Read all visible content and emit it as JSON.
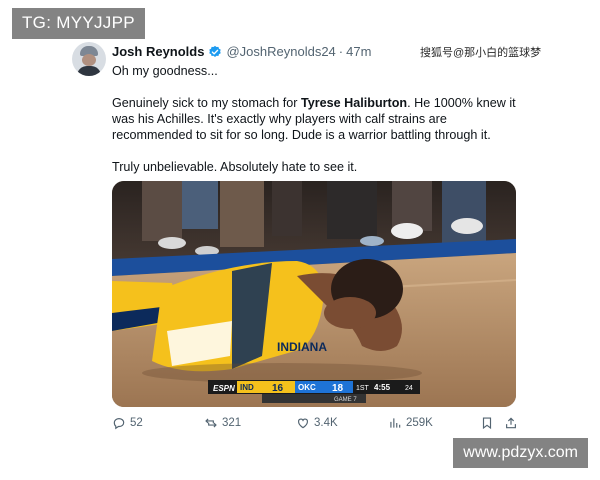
{
  "overlay": {
    "tag": "TG: MYYJJPP",
    "site": "www.pdzyx.com"
  },
  "watermark": "搜狐号@那小白的篮球梦",
  "tweet": {
    "author_name": "Josh Reynolds",
    "handle": "@JoshReynolds24",
    "time": "47m",
    "paragraph1": "Oh my goodness...",
    "p2_before": "Genuinely sick to my stomach for ",
    "p2_bold": "Tyrese Haliburton",
    "p2_after": ". He 1000% knew it was his Achilles. It's exactly why players with calf strains are recommended to sit for so long. Dude is a warrior battling through it.",
    "paragraph3": "Truly unbelievable. Absolutely hate to see it."
  },
  "scorebug": {
    "network": "ESPN",
    "team1": "IND",
    "score1": "16",
    "team2": "OKC",
    "score2": "18",
    "quarter": "1ST",
    "clock": "4:55",
    "shot_clock": "24",
    "game_label": "GAME 7",
    "jersey_text": "INDIANA"
  },
  "actions": {
    "replies": "52",
    "retweets": "321",
    "likes": "3.4K",
    "views": "259K"
  },
  "colors": {
    "accent": "#1d9bf0",
    "muted": "#536471",
    "pacers_gold": "#f5c11c",
    "pacers_navy": "#0c2a5b",
    "okc_blue": "#1e73d6"
  }
}
